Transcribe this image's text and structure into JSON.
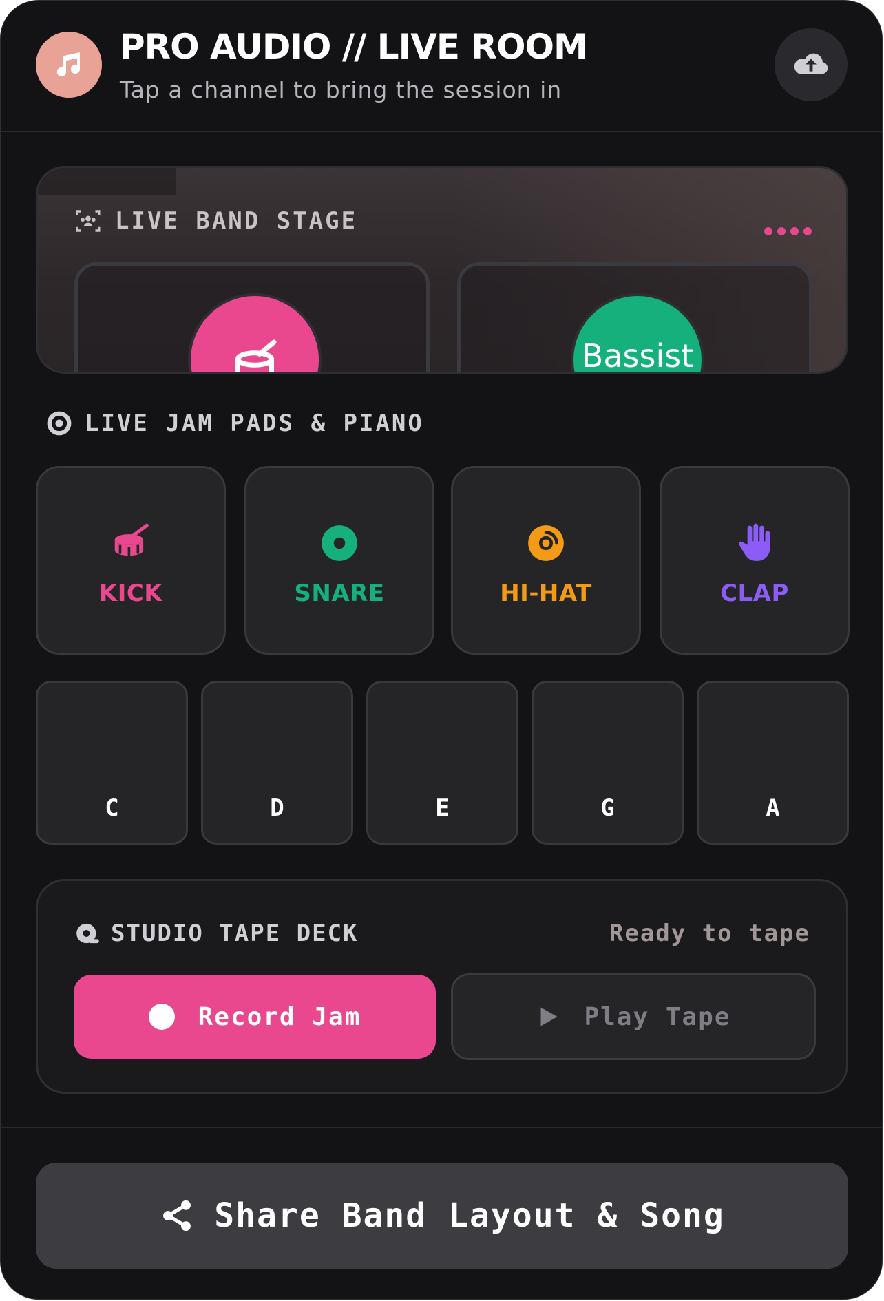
{
  "header": {
    "title": "PRO AUDIO // LIVE ROOM",
    "subtitle": "Tap a channel to bring the session in",
    "logo_icon": "music-note-icon",
    "action_icon": "cloud-upload-icon"
  },
  "stage": {
    "title": "LIVE BAND STAGE",
    "icon": "people-scan-icon",
    "musicians": [
      {
        "avatar_color": "#e9488f",
        "icon": "drum-icon"
      },
      {
        "label": "Bassist",
        "avatar_color": "#16b07c",
        "icon": "guitar-icon"
      }
    ]
  },
  "pads_section": {
    "title": "LIVE JAM PADS & PIANO",
    "pads": [
      {
        "label": "KICK",
        "color": "#e9488f",
        "icon": "drum-icon"
      },
      {
        "label": "SNARE",
        "color": "#16b07c",
        "icon": "target-icon"
      },
      {
        "label": "HI-HAT",
        "color": "#f39b16",
        "icon": "record-disc-icon"
      },
      {
        "label": "CLAP",
        "color": "#8b5cf6",
        "icon": "hand-icon"
      }
    ],
    "keys": [
      "C",
      "D",
      "E",
      "G",
      "A"
    ]
  },
  "tape_deck": {
    "title": "STUDIO TAPE DECK",
    "status": "Ready to tape",
    "record_label": "Record Jam",
    "play_label": "Play Tape"
  },
  "footer": {
    "share_label": "Share Band Layout & Song"
  },
  "colors": {
    "accent": "#e9488f",
    "background": "#131315",
    "surface": "#252528"
  }
}
